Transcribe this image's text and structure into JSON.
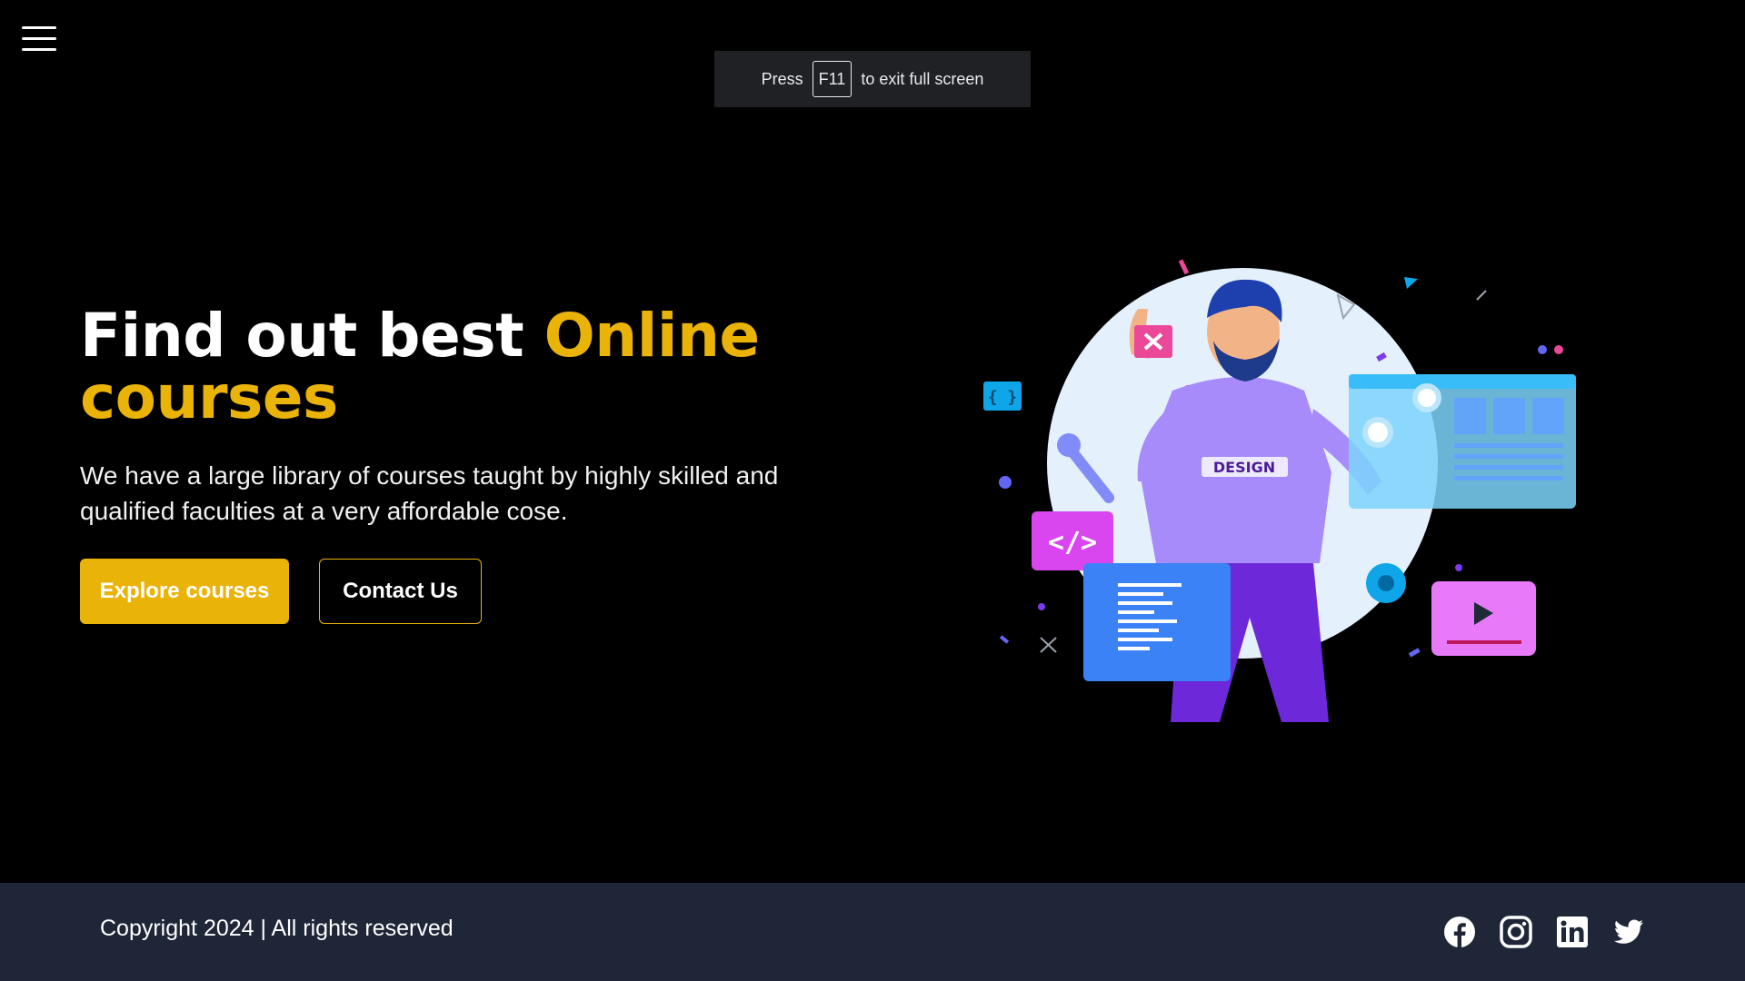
{
  "menu": {
    "icon": "hamburger-menu-icon"
  },
  "fullscreen_notice": {
    "prefix": "Press",
    "key": "F11",
    "suffix": "to exit full screen"
  },
  "hero": {
    "title_plain": "Find out best",
    "title_accent_1": "Online",
    "title_accent_2": "courses",
    "description": "We have a large library of courses taught by highly skilled and qualified faculties at a very affordable cose.",
    "primary_button": "Explore courses",
    "secondary_button": "Contact Us",
    "illustration_label": "DESIGN"
  },
  "footer": {
    "copyright": "Copyright 2024 | All rights reserved",
    "socials": [
      "facebook-icon",
      "instagram-icon",
      "linkedin-icon",
      "twitter-icon"
    ]
  },
  "colors": {
    "accent": "#eab308",
    "background": "#000000",
    "footer": "#1e2638"
  }
}
